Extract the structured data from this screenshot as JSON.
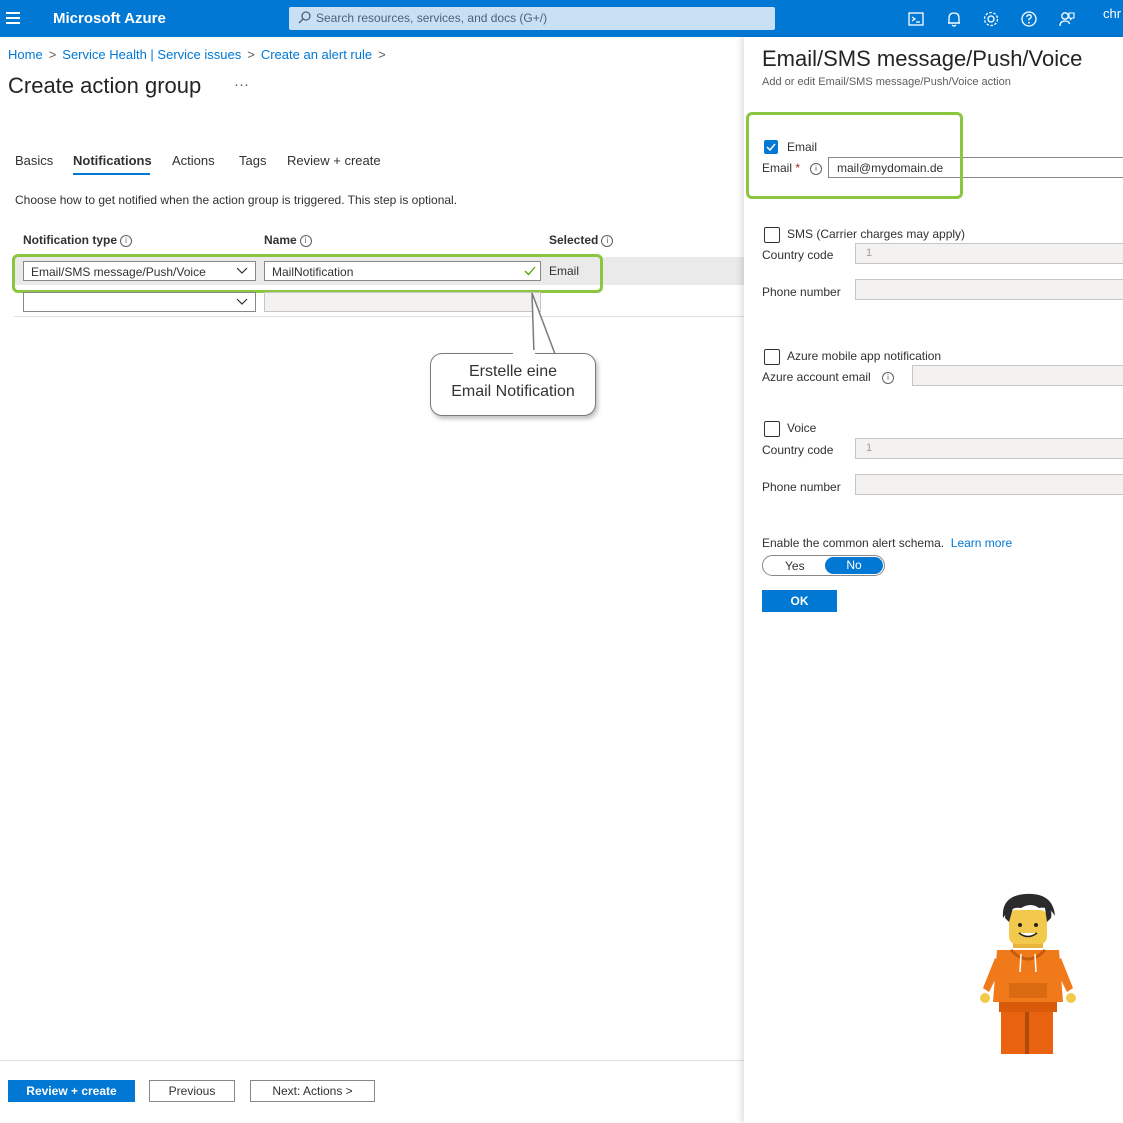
{
  "topbar": {
    "brand": "Microsoft Azure",
    "search_placeholder": "Search resources, services, and docs (G+/)",
    "user": "chr",
    "icons": [
      "cloud-shell-icon",
      "bell-icon",
      "gear-icon",
      "help-icon",
      "feedback-icon"
    ]
  },
  "breadcrumb": {
    "items": [
      "Home",
      "Service Health | Service issues",
      "Create an alert rule"
    ]
  },
  "page": {
    "title": "Create action group",
    "more": "···"
  },
  "tabs": [
    {
      "label": "Basics",
      "active": false
    },
    {
      "label": "Notifications",
      "active": true
    },
    {
      "label": "Actions",
      "active": false
    },
    {
      "label": "Tags",
      "active": false
    },
    {
      "label": "Review + create",
      "active": false
    }
  ],
  "notifications": {
    "description": "Choose how to get notified when the action group is triggered. This step is optional.",
    "columns": {
      "type": "Notification type",
      "name": "Name",
      "selected": "Selected"
    },
    "rows": [
      {
        "type": "Email/SMS message/Push/Voice",
        "name": "MailNotification",
        "selected": "Email"
      },
      {
        "type": "",
        "name": "",
        "selected": ""
      }
    ]
  },
  "callout": {
    "line1": "Erstelle eine",
    "line2": "Email Notification"
  },
  "footer": {
    "review_create": "Review + create",
    "previous": "Previous",
    "next": "Next: Actions >"
  },
  "panel": {
    "title": "Email/SMS message/Push/Voice",
    "subtitle": "Add or edit Email/SMS message/Push/Voice action",
    "email": {
      "checkbox_label": "Email",
      "checked": true,
      "field_label": "Email",
      "required": "*",
      "value": "mail@mydomain.de"
    },
    "sms": {
      "checkbox_label": "SMS (Carrier charges may apply)",
      "checked": false,
      "country_label": "Country code",
      "country_value": "1",
      "phone_label": "Phone number"
    },
    "push": {
      "checkbox_label": "Azure mobile app notification",
      "checked": false,
      "account_label": "Azure account email"
    },
    "voice": {
      "checkbox_label": "Voice",
      "checked": false,
      "country_label": "Country code",
      "country_value": "1",
      "phone_label": "Phone number"
    },
    "schema": {
      "label": "Enable the common alert schema.",
      "learn_more": "Learn more",
      "yes": "Yes",
      "no": "No",
      "selected": "No"
    },
    "ok": "OK"
  },
  "colors": {
    "azure_blue": "#0078d4",
    "highlight_green": "#8cc63f"
  }
}
